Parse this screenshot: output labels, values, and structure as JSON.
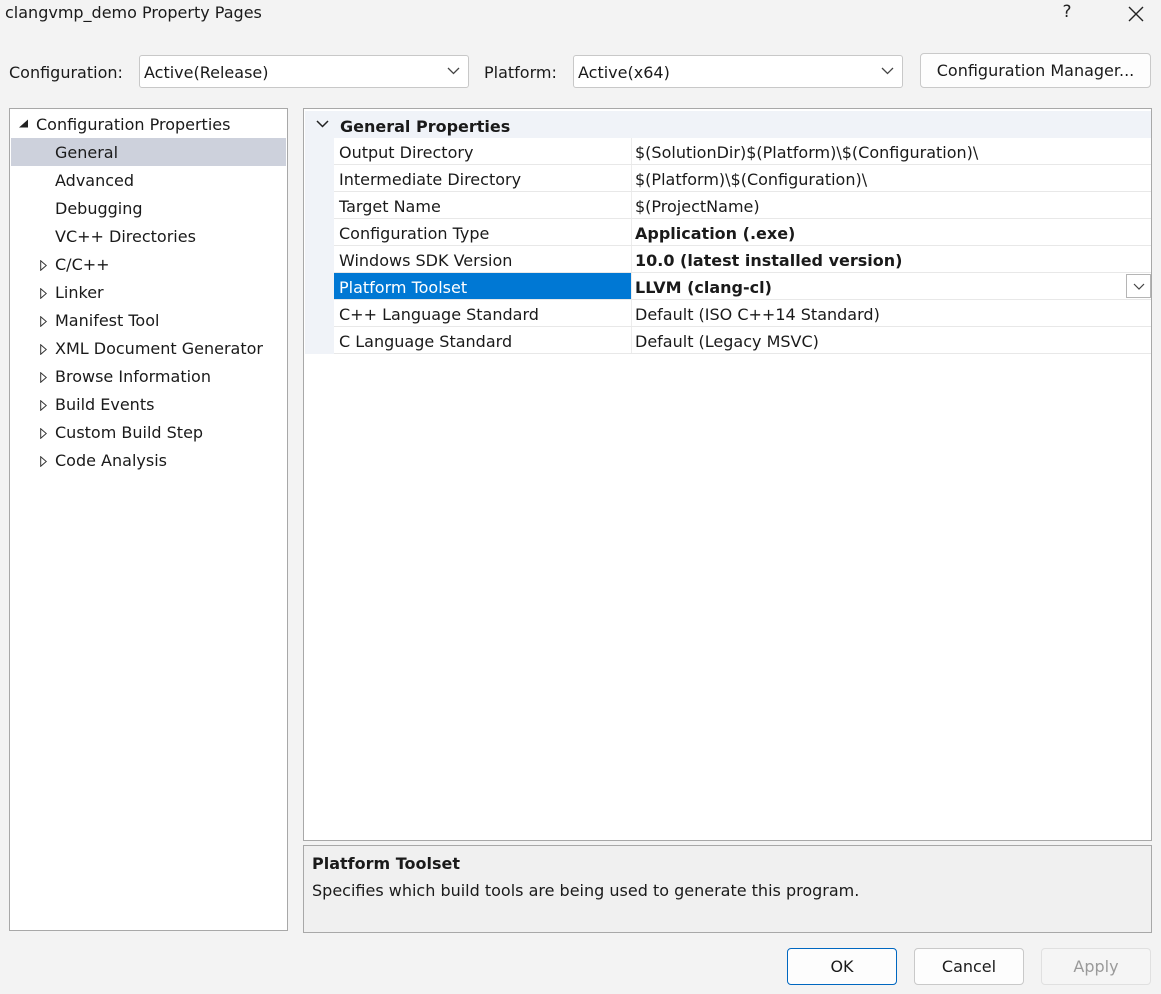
{
  "window": {
    "title": "clangvmp_demo Property Pages",
    "help_label": "?"
  },
  "toolbar": {
    "configuration_label": "Configuration:",
    "configuration_value": "Active(Release)",
    "platform_label": "Platform:",
    "platform_value": "Active(x64)",
    "config_manager_label": "Configuration Manager..."
  },
  "tree": {
    "root": "Configuration Properties",
    "items": [
      {
        "label": "General",
        "selected": true,
        "expandable": false
      },
      {
        "label": "Advanced",
        "expandable": false
      },
      {
        "label": "Debugging",
        "expandable": false
      },
      {
        "label": "VC++ Directories",
        "expandable": false
      },
      {
        "label": "C/C++",
        "expandable": true
      },
      {
        "label": "Linker",
        "expandable": true
      },
      {
        "label": "Manifest Tool",
        "expandable": true
      },
      {
        "label": "XML Document Generator",
        "expandable": true
      },
      {
        "label": "Browse Information",
        "expandable": true
      },
      {
        "label": "Build Events",
        "expandable": true
      },
      {
        "label": "Custom Build Step",
        "expandable": true
      },
      {
        "label": "Code Analysis",
        "expandable": true
      }
    ]
  },
  "grid": {
    "section_title": "General Properties",
    "rows": [
      {
        "name": "Output Directory",
        "value": "$(SolutionDir)$(Platform)\\$(Configuration)\\",
        "bold": false
      },
      {
        "name": "Intermediate Directory",
        "value": "$(Platform)\\$(Configuration)\\",
        "bold": false
      },
      {
        "name": "Target Name",
        "value": "$(ProjectName)",
        "bold": false
      },
      {
        "name": "Configuration Type",
        "value": "Application (.exe)",
        "bold": true
      },
      {
        "name": "Windows SDK Version",
        "value": "10.0 (latest installed version)",
        "bold": true
      },
      {
        "name": "Platform Toolset",
        "value": "LLVM (clang-cl)",
        "bold": true,
        "selected": true
      },
      {
        "name": "C++ Language Standard",
        "value": "Default (ISO C++14 Standard)",
        "bold": false
      },
      {
        "name": "C Language Standard",
        "value": "Default (Legacy MSVC)",
        "bold": false
      }
    ]
  },
  "description": {
    "title": "Platform Toolset",
    "text": "Specifies which build tools are being used to generate this program."
  },
  "buttons": {
    "ok": "OK",
    "cancel": "Cancel",
    "apply": "Apply"
  },
  "colors": {
    "selection_blue": "#0078d4",
    "tree_selection": "#cdd1dc",
    "window_bg": "#f3f3f3"
  }
}
